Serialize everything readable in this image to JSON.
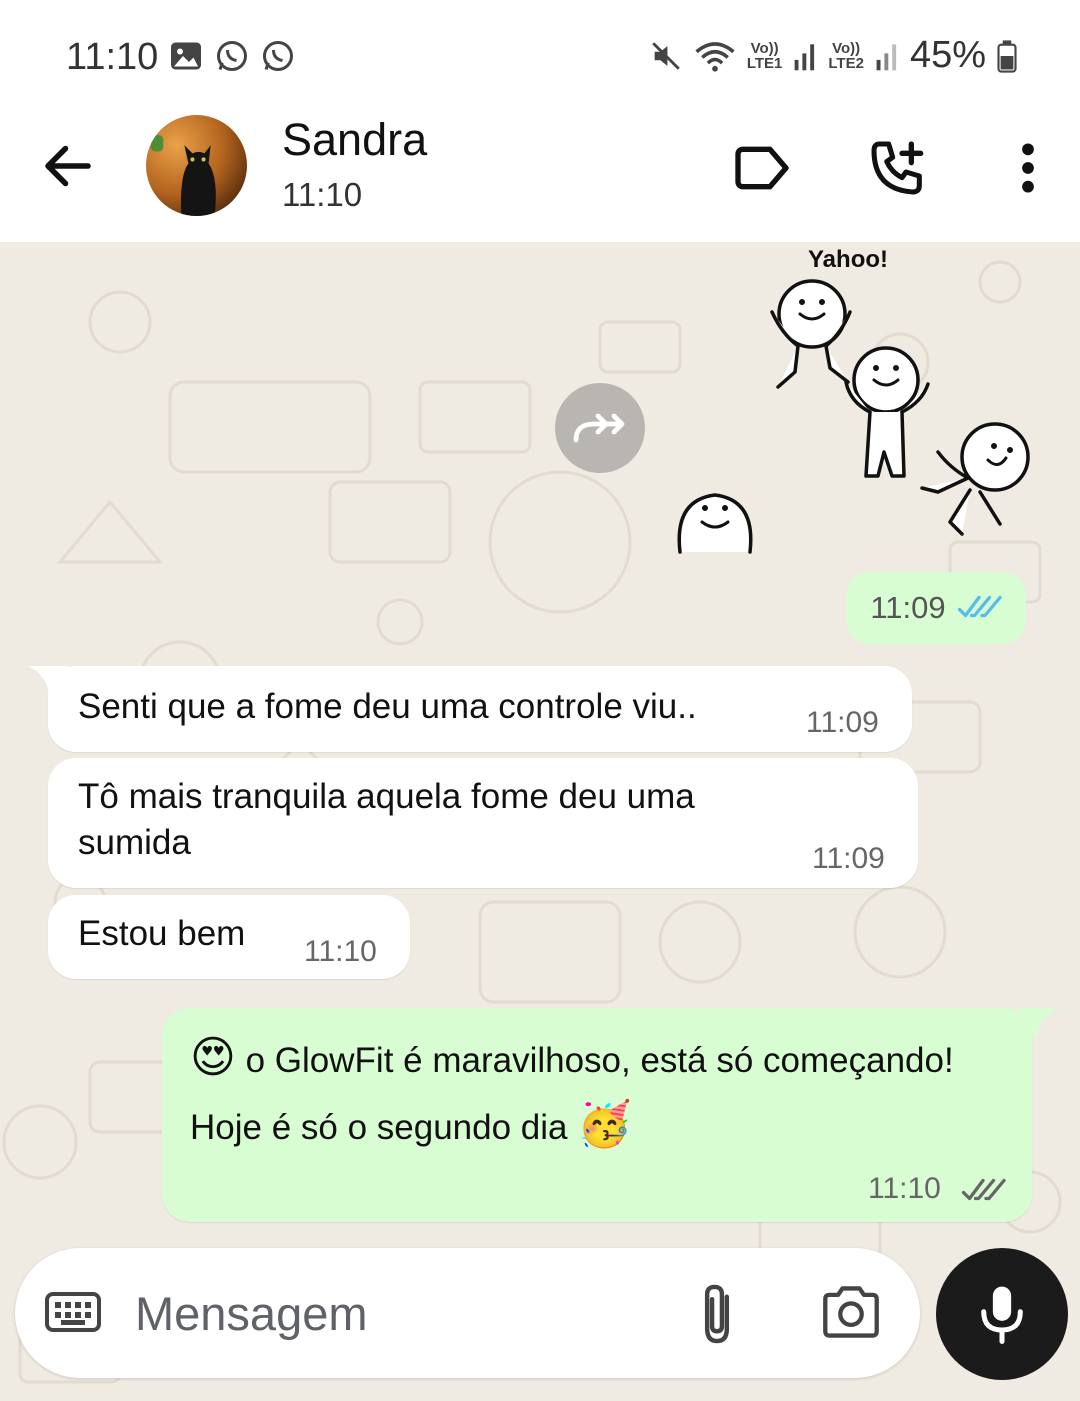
{
  "status_bar": {
    "time": "11:10",
    "sim1_label": "Vo))\nLTE1",
    "sim2_label": "Vo))\nLTE2",
    "battery": "45%",
    "icons": [
      "gallery-icon",
      "whatsapp-icon",
      "whatsapp-icon",
      "mute-icon",
      "wifi-icon",
      "signal-icon",
      "battery-icon"
    ]
  },
  "header": {
    "contact_name": "Sandra",
    "status": "11:10",
    "icons": [
      "back-arrow-icon",
      "label-icon",
      "add-call-icon",
      "more-vert-icon"
    ]
  },
  "chat": {
    "sticker_caption": "Yahoo!",
    "sticker_time": "11:09",
    "messages": [
      {
        "direction": "in",
        "text": "Senti que a fome deu uma controle viu..",
        "time": "11:09"
      },
      {
        "direction": "in",
        "text": "Tô mais tranquila aquela fome deu uma sumida",
        "time": "11:09"
      },
      {
        "direction": "in",
        "text": "Estou bem",
        "time": "11:10"
      },
      {
        "direction": "out",
        "text_emoji_start": "😍",
        "text": "o GlowFit é maravilhoso,  está só começando! Hoje é só o segundo dia",
        "text_emoji_end": "🥳",
        "time": "11:10",
        "read": false
      }
    ]
  },
  "composer": {
    "placeholder": "Mensagem",
    "icons": [
      "keyboard-icon",
      "attach-icon",
      "camera-icon",
      "mic-icon"
    ]
  },
  "colors": {
    "chat_bg": "#efeae2",
    "outgoing_bubble": "#d9fdd3",
    "incoming_bubble": "#ffffff",
    "read_tick": "#53bdeb",
    "mic_button": "#1b1b1b"
  }
}
